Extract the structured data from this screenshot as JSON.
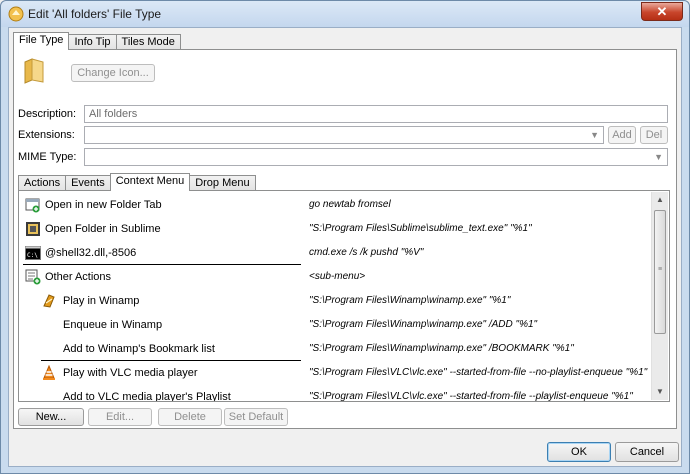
{
  "window": {
    "title": "Edit 'All folders' File Type",
    "close_label": "✕"
  },
  "top_tabs": [
    {
      "label": "File Type",
      "active": true
    },
    {
      "label": "Info Tip",
      "active": false
    },
    {
      "label": "Tiles Mode",
      "active": false
    }
  ],
  "file_type": {
    "change_icon_label": "Change Icon...",
    "description_label": "Description:",
    "description_value": "All folders",
    "extensions_label": "Extensions:",
    "extensions_value": "",
    "add_label": "Add",
    "del_label": "Del",
    "mime_label": "MIME Type:",
    "mime_value": ""
  },
  "inner_tabs": [
    {
      "label": "Actions",
      "active": false
    },
    {
      "label": "Events",
      "active": false
    },
    {
      "label": "Context Menu",
      "active": true
    },
    {
      "label": "Drop Menu",
      "active": false
    }
  ],
  "context_menu": {
    "items": [
      {
        "name": "Open in new Folder Tab",
        "command": "go newtab fromsel",
        "icon": "new-tab-icon"
      },
      {
        "name": "Open Folder in Sublime",
        "command": "\"S:\\Program Files\\Sublime\\sublime_text.exe\" \"%1\"",
        "icon": "sublime-icon"
      },
      {
        "name": "@shell32.dll,-8506",
        "command": "cmd.exe /s /k pushd \"%V\"",
        "icon": "console-icon"
      },
      {
        "name": "Other Actions",
        "command": "<sub-menu>",
        "icon": "submenu-icon"
      },
      {
        "name": "Play in Winamp",
        "command": "\"S:\\Program Files\\Winamp\\winamp.exe\" \"%1\"",
        "icon": "winamp-icon"
      },
      {
        "name": "Enqueue in Winamp",
        "command": "\"S:\\Program Files\\Winamp\\winamp.exe\" /ADD \"%1\"",
        "icon": ""
      },
      {
        "name": "Add to Winamp's Bookmark list",
        "command": "\"S:\\Program Files\\Winamp\\winamp.exe\" /BOOKMARK \"%1\"",
        "icon": ""
      },
      {
        "name": "Play with VLC media player",
        "command": "\"S:\\Program Files\\VLC\\vlc.exe\" --started-from-file --no-playlist-enqueue \"%1\"",
        "icon": "vlc-icon"
      },
      {
        "name": "Add to VLC media player's Playlist",
        "command": "\"S:\\Program Files\\VLC\\vlc.exe\" --started-from-file --playlist-enqueue \"%1\"",
        "icon": ""
      }
    ]
  },
  "list_buttons": {
    "new_label": "New...",
    "edit_label": "Edit...",
    "delete_label": "Delete",
    "set_default_label": "Set Default"
  },
  "dialog_buttons": {
    "ok_label": "OK",
    "cancel_label": "Cancel"
  }
}
